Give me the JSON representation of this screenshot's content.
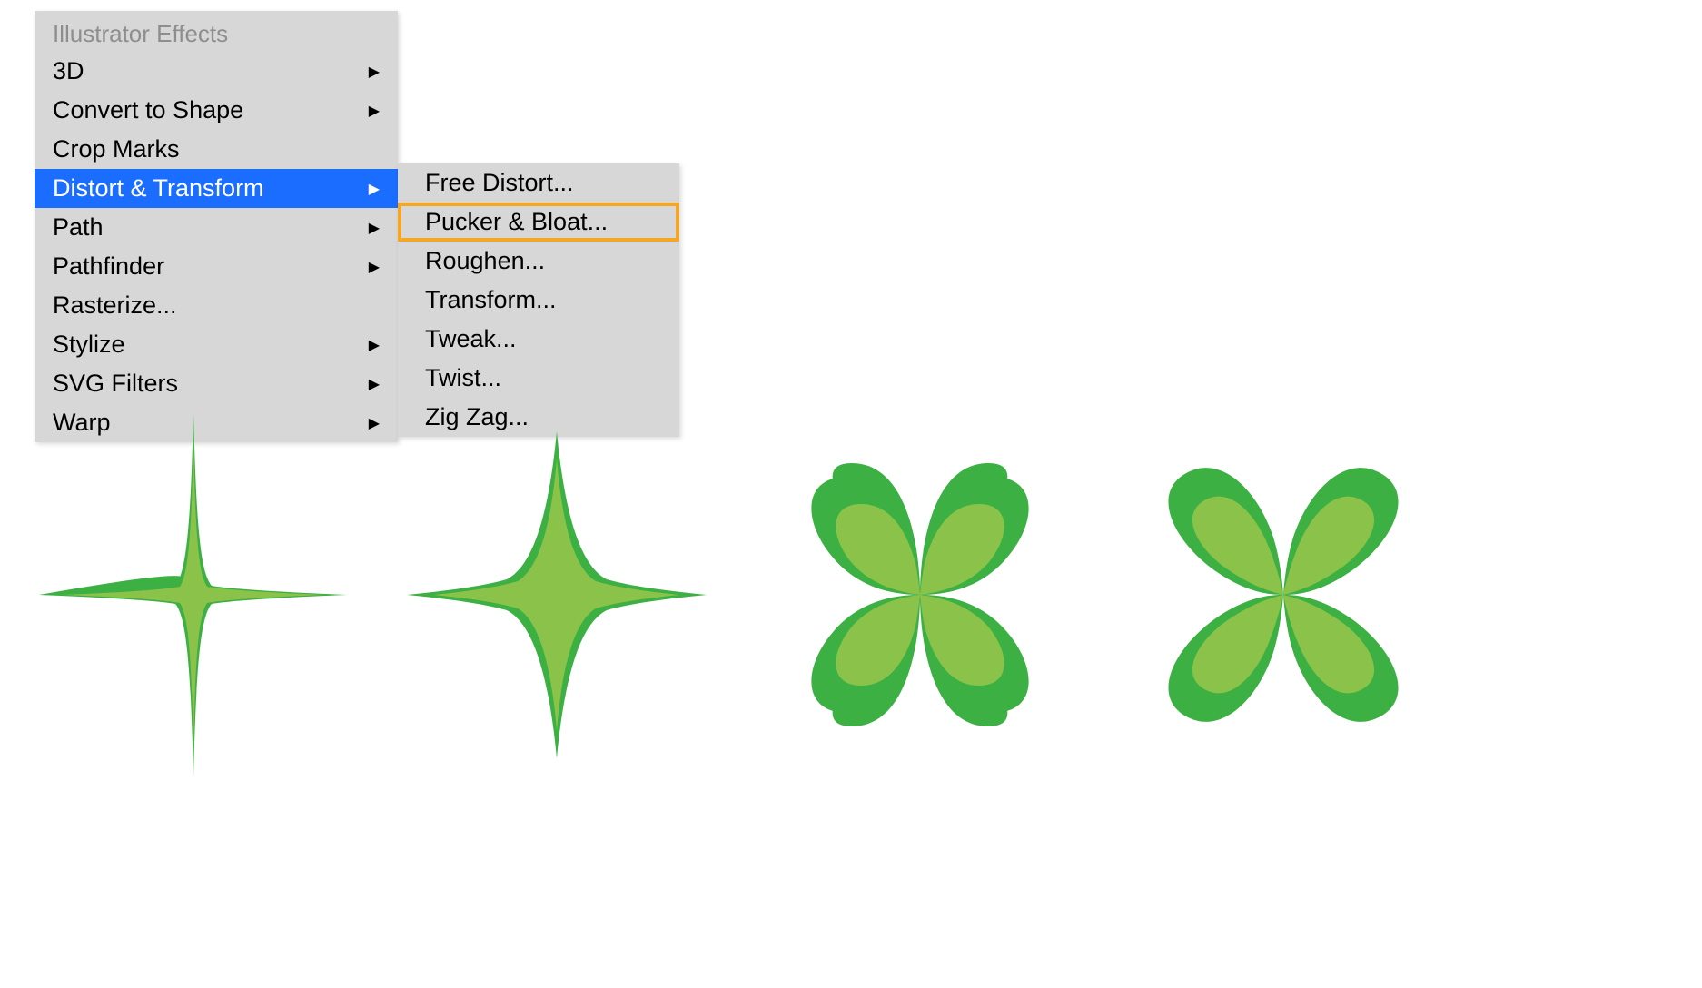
{
  "menu": {
    "header": "Illustrator Effects",
    "items": [
      {
        "label": "3D",
        "has_submenu": true,
        "active": false
      },
      {
        "label": "Convert to Shape",
        "has_submenu": true,
        "active": false
      },
      {
        "label": "Crop Marks",
        "has_submenu": false,
        "active": false
      },
      {
        "label": "Distort & Transform",
        "has_submenu": true,
        "active": true
      },
      {
        "label": "Path",
        "has_submenu": true,
        "active": false
      },
      {
        "label": "Pathfinder",
        "has_submenu": true,
        "active": false
      },
      {
        "label": "Rasterize...",
        "has_submenu": false,
        "active": false
      },
      {
        "label": "Stylize",
        "has_submenu": true,
        "active": false
      },
      {
        "label": "SVG Filters",
        "has_submenu": true,
        "active": false
      },
      {
        "label": "Warp",
        "has_submenu": true,
        "active": false
      }
    ]
  },
  "submenu": {
    "items": [
      {
        "label": "Free Distort...",
        "highlighted": false
      },
      {
        "label": "Pucker & Bloat...",
        "highlighted": true
      },
      {
        "label": "Roughen...",
        "highlighted": false
      },
      {
        "label": "Transform...",
        "highlighted": false
      },
      {
        "label": "Tweak...",
        "highlighted": false
      },
      {
        "label": "Twist...",
        "highlighted": false
      },
      {
        "label": "Zig Zag...",
        "highlighted": false
      }
    ]
  },
  "colors": {
    "menu_bg": "#d7d7d7",
    "active_bg": "#1a6dff",
    "highlight_border": "#f5a623",
    "shape_outer": "#3cb043",
    "shape_inner": "#8bc34a"
  },
  "shapes": {
    "description": "Four green pucker/bloat effect examples",
    "variants": [
      "pucker-sharp",
      "pucker-medium",
      "bloat-round",
      "bloat-petal"
    ]
  }
}
